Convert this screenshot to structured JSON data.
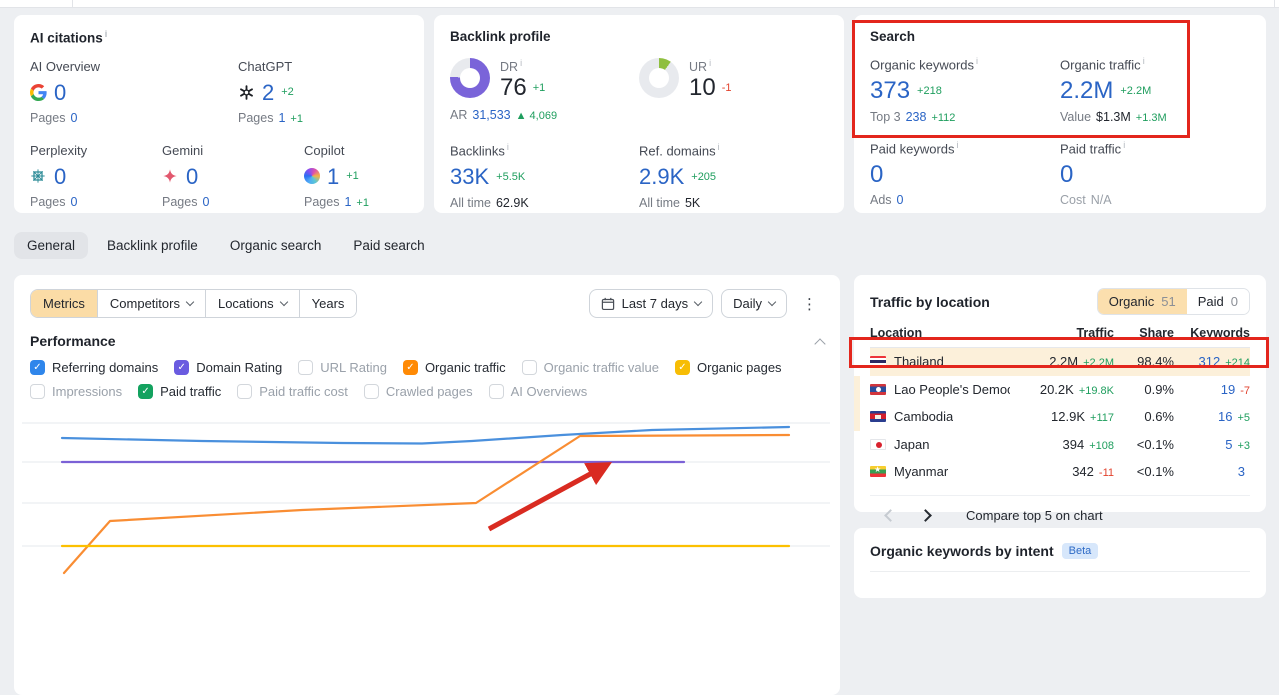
{
  "colors": {
    "accent_blue": "#2a64c5",
    "green": "#1f9e5e",
    "red": "#e2422d",
    "annotation_red": "#e3261d",
    "dr_purple": "#7a64d9",
    "ur_green": "#8fbf3f",
    "active_tan": "#fbdca6",
    "highlight_row": "#fcf0da"
  },
  "top_cards": {
    "ai_citations": {
      "title": "AI citations",
      "items": [
        {
          "label": "AI Overview",
          "icon": "google-icon",
          "value": "0",
          "delta": "",
          "pages_label": "Pages",
          "pages": "0",
          "pages_delta": ""
        },
        {
          "label": "ChatGPT",
          "icon": "openai-icon",
          "value": "2",
          "delta": "+2",
          "pages_label": "Pages",
          "pages": "1",
          "pages_delta": "+1"
        },
        {
          "label": "Perplexity",
          "icon": "perplexity-icon",
          "value": "0",
          "delta": "",
          "pages_label": "Pages",
          "pages": "0",
          "pages_delta": ""
        },
        {
          "label": "Gemini",
          "icon": "gemini-icon",
          "value": "0",
          "delta": "",
          "pages_label": "Pages",
          "pages": "0",
          "pages_delta": ""
        },
        {
          "label": "Copilot",
          "icon": "copilot-icon",
          "value": "1",
          "delta": "+1",
          "pages_label": "Pages",
          "pages": "1",
          "pages_delta": "+1"
        }
      ]
    },
    "backlink_profile": {
      "title": "Backlink profile",
      "dr": {
        "label": "DR",
        "value": "76",
        "delta": "+1",
        "percent": 76
      },
      "ar": {
        "label": "AR",
        "value": "31,533",
        "delta": "▲ 4,069"
      },
      "ur": {
        "label": "UR",
        "value": "10",
        "delta": "-1",
        "percent": 10
      },
      "backlinks": {
        "label": "Backlinks",
        "value": "33K",
        "delta": "+5.5K",
        "alltime_label": "All time",
        "alltime_value": "62.9K"
      },
      "ref_domains": {
        "label": "Ref. domains",
        "value": "2.9K",
        "delta": "+205",
        "alltime_label": "All time",
        "alltime_value": "5K"
      }
    },
    "search": {
      "title": "Search",
      "organic_keywords": {
        "label": "Organic keywords",
        "value": "373",
        "delta": "+218",
        "sub_label": "Top 3",
        "sub_value": "238",
        "sub_delta": "+112"
      },
      "organic_traffic": {
        "label": "Organic traffic",
        "value": "2.2M",
        "delta": "+2.2M",
        "sub_label": "Value",
        "sub_value": "$1.3M",
        "sub_delta": "+1.3M"
      },
      "paid_keywords": {
        "label": "Paid keywords",
        "value": "0",
        "delta": "",
        "sub_label": "Ads",
        "sub_value": "0",
        "sub_delta": ""
      },
      "paid_traffic": {
        "label": "Paid traffic",
        "value": "0",
        "delta": "",
        "sub_label": "Cost",
        "sub_value": "N/A",
        "sub_delta": ""
      }
    }
  },
  "tabs": {
    "items": [
      {
        "label": "General"
      },
      {
        "label": "Backlink profile"
      },
      {
        "label": "Organic search"
      },
      {
        "label": "Paid search"
      }
    ],
    "active": "General"
  },
  "toolbar": {
    "metrics": "Metrics",
    "competitors": "Competitors",
    "locations": "Locations",
    "years": "Years",
    "date_range": "Last 7 days",
    "granularity": "Daily"
  },
  "performance": {
    "title": "Performance",
    "checkboxes": [
      {
        "label": "Referring domains",
        "checked": true,
        "color": "#2f86eb"
      },
      {
        "label": "Domain Rating",
        "checked": true,
        "color": "#6a5be0"
      },
      {
        "label": "URL Rating",
        "checked": false
      },
      {
        "label": "Organic traffic",
        "checked": true,
        "color": "#ff8a05"
      },
      {
        "label": "Organic traffic value",
        "checked": false
      },
      {
        "label": "Organic pages",
        "checked": true,
        "color": "#f7bd05"
      },
      {
        "label": "Impressions",
        "checked": false
      },
      {
        "label": "Paid traffic",
        "checked": true,
        "color": "#13a25f"
      },
      {
        "label": "Paid traffic cost",
        "checked": false
      },
      {
        "label": "Crawled pages",
        "checked": false
      },
      {
        "label": "AI Overviews",
        "checked": false
      }
    ]
  },
  "chart_data": {
    "type": "line",
    "x_axis": "last 7 days, daily (no tick labels visible)",
    "gridlines_y": [
      26,
      65,
      106,
      149
    ],
    "series": [
      {
        "name": "Referring domains",
        "color": "#4a90dd",
        "points": [
          [
            40,
            41
          ],
          [
            180,
            44
          ],
          [
            320,
            46
          ],
          [
            400,
            46.5
          ],
          [
            450,
            44
          ],
          [
            540,
            38
          ],
          [
            630,
            33
          ],
          [
            767,
            30
          ]
        ]
      },
      {
        "name": "Domain Rating",
        "color": "#7b61d6",
        "points": [
          [
            40,
            65
          ],
          [
            662,
            65
          ]
        ]
      },
      {
        "name": "Organic traffic",
        "color": "#f98d33",
        "points": [
          [
            42,
            176
          ],
          [
            88,
            124
          ],
          [
            280,
            113
          ],
          [
            454,
            106
          ],
          [
            558,
            39
          ],
          [
            767,
            38
          ]
        ]
      },
      {
        "name": "Organic pages",
        "color": "#fcc000",
        "points": [
          [
            40,
            149
          ],
          [
            767,
            149
          ]
        ]
      }
    ],
    "annotation_arrow": {
      "from": [
        467,
        132
      ],
      "to": [
        583,
        69
      ],
      "color": "#d92b21"
    }
  },
  "traffic": {
    "title": "Traffic by location",
    "toggle": {
      "organic_label": "Organic",
      "organic_count": "51",
      "paid_label": "Paid",
      "paid_count": "0"
    },
    "columns": {
      "location": "Location",
      "traffic": "Traffic",
      "share": "Share",
      "keywords": "Keywords"
    },
    "rows": [
      {
        "name": "Thailand",
        "flag": "thailand-flag",
        "traffic": "2.2M",
        "traffic_delta": "+2.2M",
        "share": "98.4%",
        "keywords": "312",
        "keywords_delta": "+214"
      },
      {
        "name": "Lao People's Democratic Reput",
        "flag": "laos-flag",
        "traffic": "20.2K",
        "traffic_delta": "+19.8K",
        "share": "0.9%",
        "keywords": "19",
        "keywords_delta": "-7"
      },
      {
        "name": "Cambodia",
        "flag": "cambodia-flag",
        "traffic": "12.9K",
        "traffic_delta": "+117",
        "share": "0.6%",
        "keywords": "16",
        "keywords_delta": "+5"
      },
      {
        "name": "Japan",
        "flag": "japan-flag",
        "traffic": "394",
        "traffic_delta": "+108",
        "share": "<0.1%",
        "keywords": "5",
        "keywords_delta": "+3"
      },
      {
        "name": "Myanmar",
        "flag": "myanmar-flag",
        "traffic": "342",
        "traffic_delta": "-11",
        "share": "<0.1%",
        "keywords": "3",
        "keywords_delta": ""
      }
    ],
    "footer": {
      "compare_label": "Compare top 5 on chart"
    }
  },
  "intent": {
    "title": "Organic keywords by intent",
    "badge": "Beta"
  }
}
